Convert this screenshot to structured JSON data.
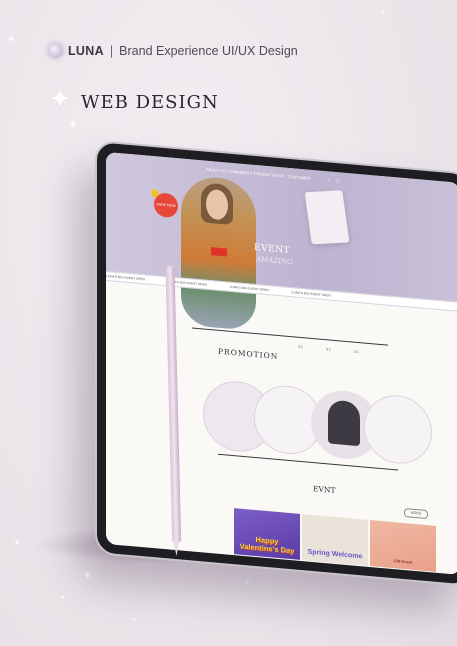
{
  "header": {
    "brand_name": "LUNA",
    "separator": "|",
    "brand_subtitle": "Brand Experience UI/UX Design",
    "section_title": "WEB DESIGN"
  },
  "screen": {
    "nav_items": [
      "ABOUT US",
      "COMMUNITY",
      "PRODUCT",
      "SHOP",
      "CUSTOMER"
    ],
    "hero_badge": "SHOP NOW",
    "hero_event": "EVENT",
    "hero_event_sub": "AMAZING",
    "ticker_items": [
      "LUNA'S BIG EVENT OPEN",
      "LUNA'S BIG EVENT OPEN",
      "LUNA'S BIG EVENT OPEN",
      "LUNA'S BIG EVENT OPEN"
    ],
    "promotion_title": "PROMOTION",
    "promo_numbers": [
      "3.1",
      "3.1",
      "3.1"
    ],
    "event_title": "EVNT",
    "more_label": "MORE",
    "event_cards": [
      {
        "text": "Happy Valentine's Day"
      },
      {
        "text": "Spring Welcome"
      },
      {
        "text": "Gift Event"
      }
    ]
  },
  "colors": {
    "hero_bg": "#bdb4d0",
    "accent_red": "#e9463a",
    "accent_yellow": "#f1c32b",
    "card_purple": "#6b4fb8",
    "card_peach": "#f0b8a2"
  }
}
